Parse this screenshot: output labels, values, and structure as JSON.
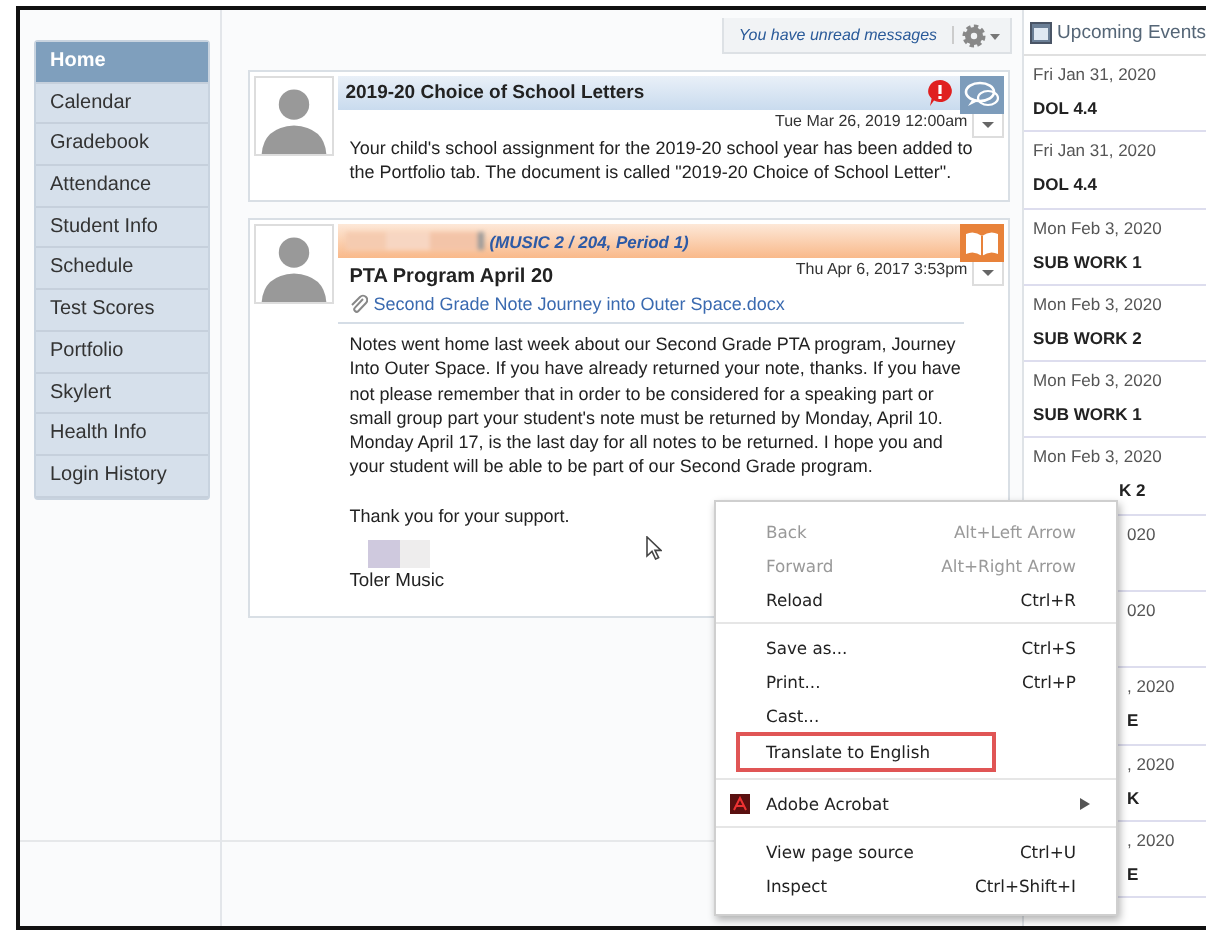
{
  "sidebar": {
    "items": [
      {
        "label": "Home",
        "selected": true
      },
      {
        "label": "Calendar",
        "selected": false
      },
      {
        "label": "Gradebook",
        "selected": false
      },
      {
        "label": "Attendance",
        "selected": false
      },
      {
        "label": "Student Info",
        "selected": false
      },
      {
        "label": "Schedule",
        "selected": false
      },
      {
        "label": "Test Scores",
        "selected": false
      },
      {
        "label": "Portfolio",
        "selected": false
      },
      {
        "label": "Skylert",
        "selected": false
      },
      {
        "label": "Health Info",
        "selected": false
      },
      {
        "label": "Login History",
        "selected": false
      }
    ]
  },
  "notice": {
    "text": "You have unread messages"
  },
  "posts": [
    {
      "kind": "message",
      "header": "2019-20 Choice of School Letters",
      "unread": true,
      "date": "Tue Mar 26, 2019 12:00am",
      "body": [
        "Your child's school assignment for the 2019-20 school year has been added to the Portfolio tab. The document is called \"2019-20 Choice of School Letter\"."
      ]
    },
    {
      "kind": "class",
      "header": "(MUSIC 2 / 204, Period 1)",
      "unread": false,
      "title": "PTA Program April 20",
      "date": "Thu Apr 6, 2017 3:53pm",
      "attachment": "Second Grade Note Journey into Outer Space.docx",
      "body": [
        "Notes went home last week about our Second Grade PTA program, Journey Into Outer Space. If you have already returned your note, thanks. If you have not please remember that in order to be considered for a speaking part or small group part your student's note must be returned by Monday, April 10. Monday April 17, is the last day for all notes to be returned. I hope you and your student will be able to be part of our Second Grade program.",
        "Thank you for your support."
      ],
      "signature": "Toler Music"
    }
  ],
  "events": {
    "title": "Upcoming Events",
    "items": [
      {
        "kind": "full",
        "date": "Fri Jan 31, 2020",
        "title": "DOL 4.4"
      },
      {
        "kind": "full",
        "date": "Fri Jan 31, 2020",
        "title": "DOL 4.4"
      },
      {
        "kind": "full",
        "date": "Mon Feb 3, 2020",
        "title": "SUB WORK 1"
      },
      {
        "kind": "full",
        "date": "Mon Feb 3, 2020",
        "title": "SUB WORK 2"
      },
      {
        "kind": "full",
        "date": "Mon Feb 3, 2020",
        "title": "SUB WORK 1"
      },
      {
        "kind": "full",
        "date": "Mon Feb 3, 2020",
        "title": "K 2",
        "cut": true
      },
      {
        "kind": "covered",
        "date": "020"
      },
      {
        "kind": "covered",
        "date": "020"
      },
      {
        "kind": "covered",
        "date": ", 2020",
        "title": "E"
      },
      {
        "kind": "covered",
        "date": ", 2020",
        "title": "K"
      },
      {
        "kind": "covered",
        "date": ", 2020",
        "title": "E"
      }
    ]
  },
  "context_menu": {
    "groups": [
      [
        {
          "label": "Back",
          "shortcut": "Alt+Left Arrow",
          "disabled": true,
          "highlighted": false
        },
        {
          "label": "Forward",
          "shortcut": "Alt+Right Arrow",
          "disabled": true,
          "highlighted": false
        },
        {
          "label": "Reload",
          "shortcut": "Ctrl+R",
          "disabled": false,
          "highlighted": false
        }
      ],
      [
        {
          "label": "Save as...",
          "shortcut": "Ctrl+S",
          "disabled": false,
          "highlighted": false
        },
        {
          "label": "Print...",
          "shortcut": "Ctrl+P",
          "disabled": false,
          "highlighted": false
        },
        {
          "label": "Cast...",
          "disabled": false,
          "highlighted": false
        },
        {
          "label": "Translate to English",
          "disabled": false,
          "highlighted": true
        }
      ],
      [
        {
          "label": "Adobe Acrobat",
          "disabled": false,
          "highlighted": false,
          "submenu": true,
          "icon": true
        }
      ],
      [
        {
          "label": "View page source",
          "shortcut": "Ctrl+U",
          "disabled": false,
          "highlighted": false
        },
        {
          "label": "Inspect",
          "shortcut": "Ctrl+Shift+I",
          "disabled": false,
          "highlighted": false
        }
      ]
    ]
  }
}
